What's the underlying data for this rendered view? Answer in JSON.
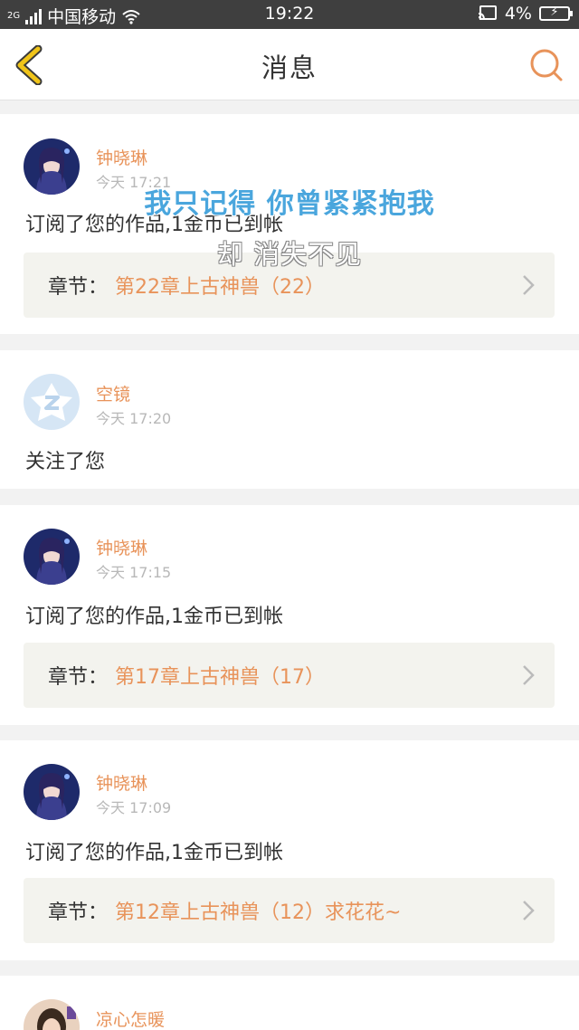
{
  "status_bar": {
    "network": "2G",
    "carrier": "中国移动",
    "time": "19:22",
    "battery": "4%"
  },
  "header": {
    "title": "消息",
    "back_icon": "chevron-left-icon",
    "search_icon": "search-icon"
  },
  "colors": {
    "accent": "#e8935a",
    "back_icon": "#f0c419",
    "overlay_text": "#4aa6dd"
  },
  "messages": [
    {
      "user": "钟晓琳",
      "time": "今天 17:21",
      "text": "订阅了您的作品,1金币已到帐",
      "chapter_label": "章节：",
      "chapter_value": "第22章上古神兽（22）"
    },
    {
      "user": "空镜",
      "time": "今天 17:20",
      "text": "关注了您"
    },
    {
      "user": "钟晓琳",
      "time": "今天 17:15",
      "text": "订阅了您的作品,1金币已到帐",
      "chapter_label": "章节：",
      "chapter_value": "第17章上古神兽（17）"
    },
    {
      "user": "钟晓琳",
      "time": "今天 17:09",
      "text": "订阅了您的作品,1金币已到帐",
      "chapter_label": "章节：",
      "chapter_value": "第12章上古神兽（12）求花花~"
    },
    {
      "user": "凉心怎暖"
    }
  ],
  "overlay": {
    "line1": "我只记得 你曾紧紧抱我",
    "line2": "却 消失不见"
  }
}
